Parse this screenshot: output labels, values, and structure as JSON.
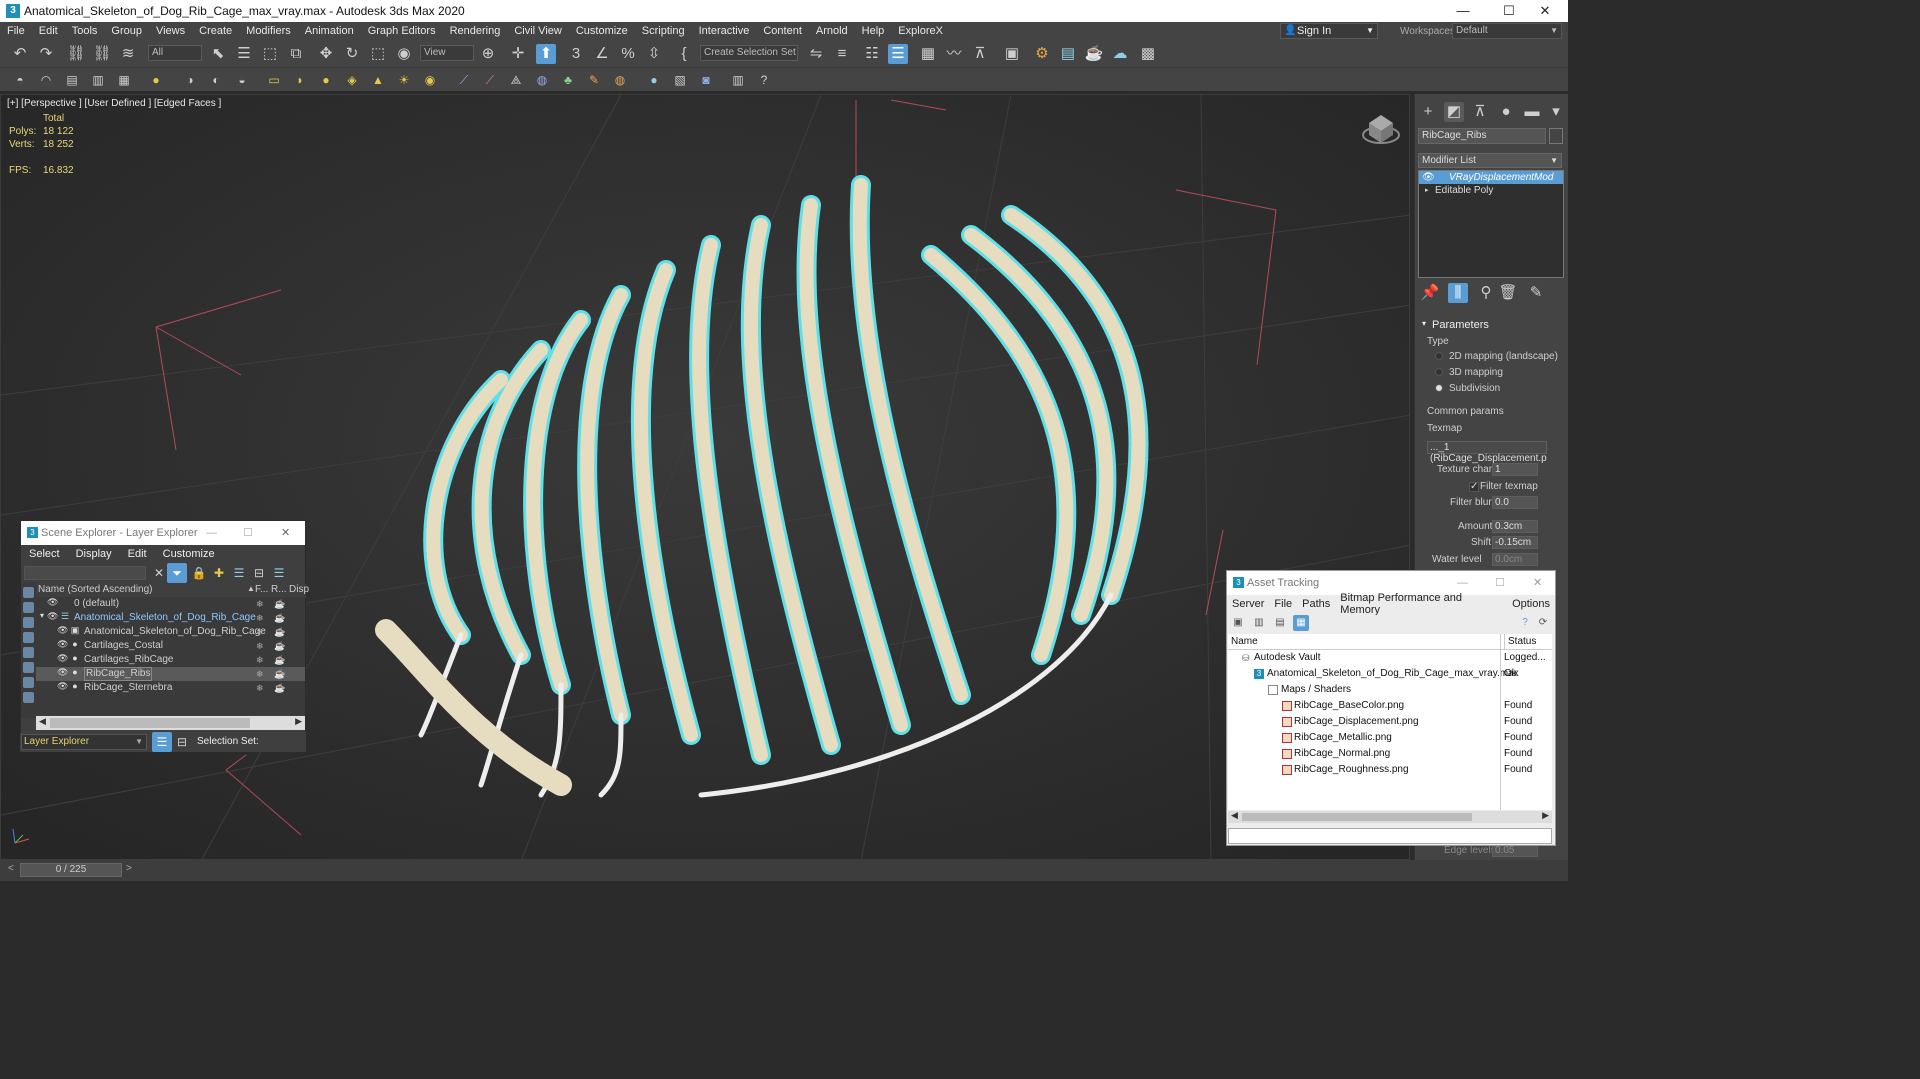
{
  "window": {
    "title": "Anatomical_Skeleton_of_Dog_Rib_Cage_max_vray.max - Autodesk 3ds Max 2020",
    "minimize": "—",
    "maximize": "☐",
    "close": "✕"
  },
  "menubar": [
    "File",
    "Edit",
    "Tools",
    "Group",
    "Views",
    "Create",
    "Modifiers",
    "Animation",
    "Graph Editors",
    "Rendering",
    "Civil View",
    "Customize",
    "Scripting",
    "Interactive",
    "Content",
    "Arnold",
    "Help",
    "ExploreX"
  ],
  "signin": {
    "label": "Sign In"
  },
  "workspace": {
    "label": "Workspaces:",
    "value": "Default"
  },
  "toolbar": {
    "filter_value": "All",
    "view_value": "View",
    "selection_set": "Create Selection Set"
  },
  "viewport": {
    "label": "[+] [Perspective ] [User Defined ] [Edged Faces ]",
    "stats": {
      "total_label": "Total",
      "polys_label": "Polys:",
      "polys": "18 122",
      "verts_label": "Verts:",
      "verts": "18 252",
      "fps_label": "FPS:",
      "fps": "16.832"
    }
  },
  "command_panel": {
    "object_name": "RibCage_Ribs",
    "modifier_list": "Modifier List",
    "stack": [
      "VRayDisplacementMod",
      "Editable Poly"
    ],
    "parameters_title": "Parameters",
    "type_label": "Type",
    "type_options": [
      "2D mapping (landscape)",
      "3D mapping",
      "Subdivision"
    ],
    "type_selected": 2,
    "common_params": "Common params",
    "texmap_label": "Texmap",
    "texmap_value": "..._1 (RibCage_Displacement.p",
    "texture_chan_label": "Texture chan",
    "texture_chan": "1",
    "filter_texmap": "Filter texmap",
    "filter_blur_label": "Filter blur",
    "filter_blur": "0.0",
    "amount_label": "Amount",
    "amount": "0.3cm",
    "shift_label": "Shift",
    "shift": "-0.15cm",
    "water_level_label": "Water level",
    "water_level": "0.0cm",
    "edge_levels_label": "Edge levels",
    "edge_levels": "0.05"
  },
  "scene_explorer": {
    "title": "Scene Explorer - Layer Explorer",
    "menu": [
      "Select",
      "Display",
      "Edit",
      "Customize"
    ],
    "columns": [
      "Name (Sorted Ascending)",
      "F...",
      "R...",
      "Disp"
    ],
    "rows": [
      {
        "name": "0 (default)"
      },
      {
        "name": "Anatomical_Skeleton_of_Dog_Rib_Cage"
      },
      {
        "name": "Anatomical_Skeleton_of_Dog_Rib_Cage"
      },
      {
        "name": "Cartilages_Costal"
      },
      {
        "name": "Cartilages_RibCage"
      },
      {
        "name": "RibCage_Ribs"
      },
      {
        "name": "RibCage_Sternebra"
      }
    ],
    "footer_left": "Layer Explorer",
    "footer_right": "Selection Set:"
  },
  "asset_tracking": {
    "title": "Asset Tracking",
    "menu": [
      "Server",
      "File",
      "Paths",
      "Bitmap Performance and Memory",
      "Options"
    ],
    "columns": [
      "Name",
      "Status"
    ],
    "rows": [
      {
        "name": "Autodesk Vault",
        "status": "Logged..."
      },
      {
        "name": "Anatomical_Skeleton_of_Dog_Rib_Cage_max_vray.max",
        "status": "Ok"
      },
      {
        "name": "Maps / Shaders",
        "status": ""
      },
      {
        "name": "RibCage_BaseColor.png",
        "status": "Found"
      },
      {
        "name": "RibCage_Displacement.png",
        "status": "Found"
      },
      {
        "name": "RibCage_Metallic.png",
        "status": "Found"
      },
      {
        "name": "RibCage_Normal.png",
        "status": "Found"
      },
      {
        "name": "RibCage_Roughness.png",
        "status": "Found"
      }
    ]
  },
  "timeline": {
    "frame": "0 / 225"
  },
  "colors": {
    "accent": "#5a9cd4",
    "stats": "#e6d87a",
    "wire": "#5fe0e8",
    "bone": "#e6dcc0"
  }
}
